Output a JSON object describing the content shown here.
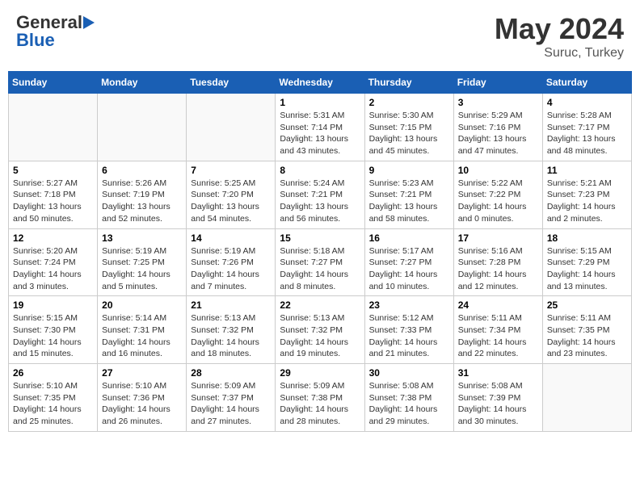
{
  "header": {
    "logo_general": "General",
    "logo_blue": "Blue",
    "title": "May 2024",
    "location": "Suruc, Turkey"
  },
  "weekdays": [
    "Sunday",
    "Monday",
    "Tuesday",
    "Wednesday",
    "Thursday",
    "Friday",
    "Saturday"
  ],
  "weeks": [
    [
      {
        "day": "",
        "text": ""
      },
      {
        "day": "",
        "text": ""
      },
      {
        "day": "",
        "text": ""
      },
      {
        "day": "1",
        "text": "Sunrise: 5:31 AM\nSunset: 7:14 PM\nDaylight: 13 hours\nand 43 minutes."
      },
      {
        "day": "2",
        "text": "Sunrise: 5:30 AM\nSunset: 7:15 PM\nDaylight: 13 hours\nand 45 minutes."
      },
      {
        "day": "3",
        "text": "Sunrise: 5:29 AM\nSunset: 7:16 PM\nDaylight: 13 hours\nand 47 minutes."
      },
      {
        "day": "4",
        "text": "Sunrise: 5:28 AM\nSunset: 7:17 PM\nDaylight: 13 hours\nand 48 minutes."
      }
    ],
    [
      {
        "day": "5",
        "text": "Sunrise: 5:27 AM\nSunset: 7:18 PM\nDaylight: 13 hours\nand 50 minutes."
      },
      {
        "day": "6",
        "text": "Sunrise: 5:26 AM\nSunset: 7:19 PM\nDaylight: 13 hours\nand 52 minutes."
      },
      {
        "day": "7",
        "text": "Sunrise: 5:25 AM\nSunset: 7:20 PM\nDaylight: 13 hours\nand 54 minutes."
      },
      {
        "day": "8",
        "text": "Sunrise: 5:24 AM\nSunset: 7:21 PM\nDaylight: 13 hours\nand 56 minutes."
      },
      {
        "day": "9",
        "text": "Sunrise: 5:23 AM\nSunset: 7:21 PM\nDaylight: 13 hours\nand 58 minutes."
      },
      {
        "day": "10",
        "text": "Sunrise: 5:22 AM\nSunset: 7:22 PM\nDaylight: 14 hours\nand 0 minutes."
      },
      {
        "day": "11",
        "text": "Sunrise: 5:21 AM\nSunset: 7:23 PM\nDaylight: 14 hours\nand 2 minutes."
      }
    ],
    [
      {
        "day": "12",
        "text": "Sunrise: 5:20 AM\nSunset: 7:24 PM\nDaylight: 14 hours\nand 3 minutes."
      },
      {
        "day": "13",
        "text": "Sunrise: 5:19 AM\nSunset: 7:25 PM\nDaylight: 14 hours\nand 5 minutes."
      },
      {
        "day": "14",
        "text": "Sunrise: 5:19 AM\nSunset: 7:26 PM\nDaylight: 14 hours\nand 7 minutes."
      },
      {
        "day": "15",
        "text": "Sunrise: 5:18 AM\nSunset: 7:27 PM\nDaylight: 14 hours\nand 8 minutes."
      },
      {
        "day": "16",
        "text": "Sunrise: 5:17 AM\nSunset: 7:27 PM\nDaylight: 14 hours\nand 10 minutes."
      },
      {
        "day": "17",
        "text": "Sunrise: 5:16 AM\nSunset: 7:28 PM\nDaylight: 14 hours\nand 12 minutes."
      },
      {
        "day": "18",
        "text": "Sunrise: 5:15 AM\nSunset: 7:29 PM\nDaylight: 14 hours\nand 13 minutes."
      }
    ],
    [
      {
        "day": "19",
        "text": "Sunrise: 5:15 AM\nSunset: 7:30 PM\nDaylight: 14 hours\nand 15 minutes."
      },
      {
        "day": "20",
        "text": "Sunrise: 5:14 AM\nSunset: 7:31 PM\nDaylight: 14 hours\nand 16 minutes."
      },
      {
        "day": "21",
        "text": "Sunrise: 5:13 AM\nSunset: 7:32 PM\nDaylight: 14 hours\nand 18 minutes."
      },
      {
        "day": "22",
        "text": "Sunrise: 5:13 AM\nSunset: 7:32 PM\nDaylight: 14 hours\nand 19 minutes."
      },
      {
        "day": "23",
        "text": "Sunrise: 5:12 AM\nSunset: 7:33 PM\nDaylight: 14 hours\nand 21 minutes."
      },
      {
        "day": "24",
        "text": "Sunrise: 5:11 AM\nSunset: 7:34 PM\nDaylight: 14 hours\nand 22 minutes."
      },
      {
        "day": "25",
        "text": "Sunrise: 5:11 AM\nSunset: 7:35 PM\nDaylight: 14 hours\nand 23 minutes."
      }
    ],
    [
      {
        "day": "26",
        "text": "Sunrise: 5:10 AM\nSunset: 7:35 PM\nDaylight: 14 hours\nand 25 minutes."
      },
      {
        "day": "27",
        "text": "Sunrise: 5:10 AM\nSunset: 7:36 PM\nDaylight: 14 hours\nand 26 minutes."
      },
      {
        "day": "28",
        "text": "Sunrise: 5:09 AM\nSunset: 7:37 PM\nDaylight: 14 hours\nand 27 minutes."
      },
      {
        "day": "29",
        "text": "Sunrise: 5:09 AM\nSunset: 7:38 PM\nDaylight: 14 hours\nand 28 minutes."
      },
      {
        "day": "30",
        "text": "Sunrise: 5:08 AM\nSunset: 7:38 PM\nDaylight: 14 hours\nand 29 minutes."
      },
      {
        "day": "31",
        "text": "Sunrise: 5:08 AM\nSunset: 7:39 PM\nDaylight: 14 hours\nand 30 minutes."
      },
      {
        "day": "",
        "text": ""
      }
    ]
  ]
}
